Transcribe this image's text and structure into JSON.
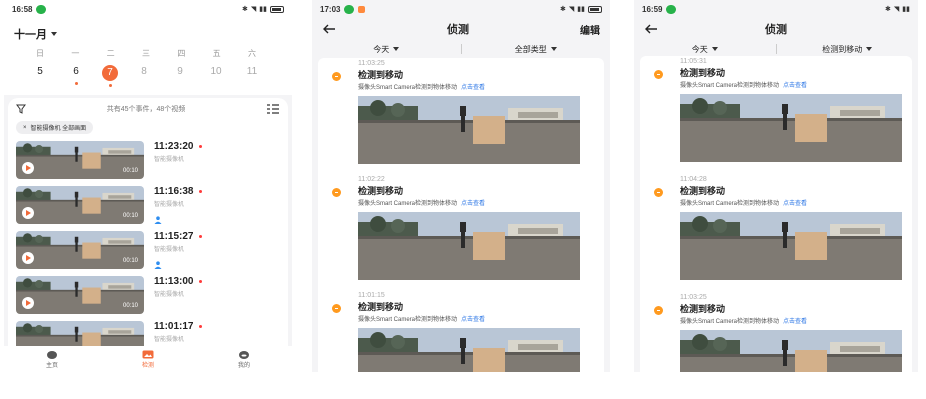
{
  "phone1": {
    "status": {
      "time": "16:58",
      "pill": ""
    },
    "month": "十一月",
    "weekdays": [
      "日",
      "一",
      "二",
      "三",
      "四",
      "五",
      "六"
    ],
    "dates": [
      "5",
      "6",
      "7",
      "8",
      "9",
      "10",
      "11"
    ],
    "summary": "共有45个事件，48个视频",
    "chip": "智能摄像机 全部画面",
    "events": [
      {
        "time": "11:23:20",
        "camera": "智能摄像机",
        "duration": "00:10"
      },
      {
        "time": "11:16:38",
        "camera": "智能摄像机",
        "duration": "00:10"
      },
      {
        "time": "11:15:27",
        "camera": "智能摄像机",
        "duration": "00:10"
      },
      {
        "time": "11:13:00",
        "camera": "智能摄像机",
        "duration": "00:10"
      },
      {
        "time": "11:01:17",
        "camera": "智能摄像机",
        "duration": ""
      }
    ],
    "tabs": [
      "主页",
      "检测",
      "我的"
    ]
  },
  "phone2": {
    "status": {
      "time": "17:03",
      "pill": ""
    },
    "title": "侦测",
    "edit": "编辑",
    "filter_date": "今天",
    "filter_type": "全部类型",
    "items": [
      {
        "time": "11:03:25",
        "title": "检测到移动",
        "desc": "摄像头Smart Camera检测到物体移动",
        "link": "点击查看"
      },
      {
        "time": "11:02:22",
        "title": "检测到移动",
        "desc": "摄像头Smart Camera检测到物体移动",
        "link": "点击查看"
      },
      {
        "time": "11:01:15",
        "title": "检测到移动",
        "desc": "摄像头Smart Camera检测到物体移动",
        "link": "点击查看"
      }
    ]
  },
  "phone3": {
    "status": {
      "time": "16:59",
      "pill": ""
    },
    "title": "侦测",
    "filter_date": "今天",
    "filter_type": "检测到移动",
    "items": [
      {
        "time": "11:05:31",
        "title": "检测到移动",
        "desc": "摄像头Smart Camera检测到物体移动",
        "link": "点击查看"
      },
      {
        "time": "11:04:28",
        "title": "检测到移动",
        "desc": "摄像头Smart Camera检测到物体移动",
        "link": "点击查看"
      },
      {
        "time": "11:03:25",
        "title": "检测到移动",
        "desc": "摄像头Smart Camera检测到物体移动",
        "link": "点击查看"
      }
    ]
  },
  "colors": {
    "accent": "#f26b3a",
    "badge": "#ff9a1f",
    "link": "#2f78e6",
    "pill": "#27b24a"
  }
}
